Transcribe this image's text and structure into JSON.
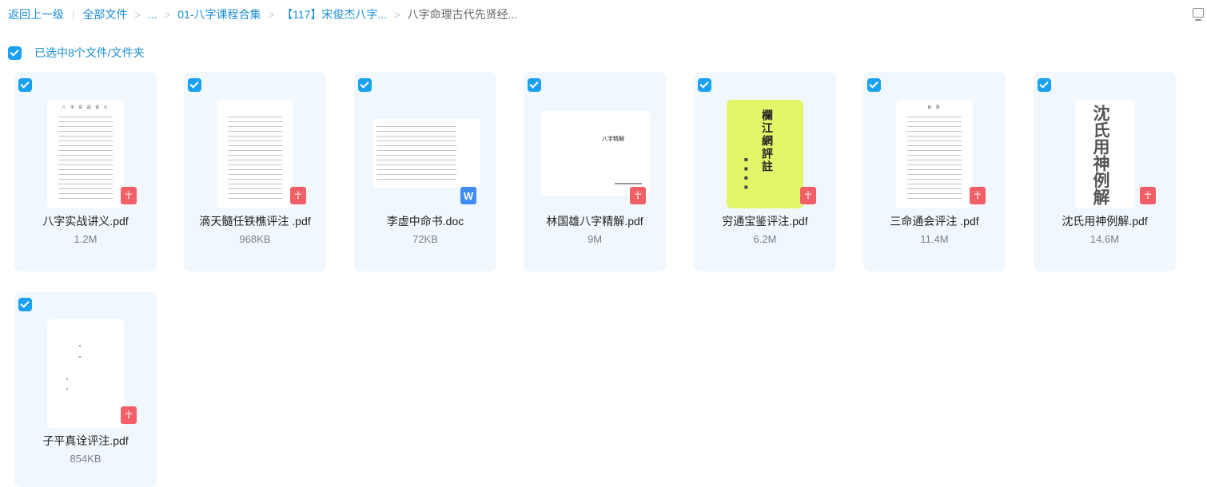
{
  "breadcrumb": {
    "back": "返回上一级",
    "all_files": "全部文件",
    "ellipsis": "...",
    "level1": "01-八字课程合集",
    "level2": "【117】宋俊杰八字...",
    "current": "八字命理古代先贤经..."
  },
  "selection": {
    "text": "已选中8个文件/文件夹"
  },
  "files": [
    {
      "name": "八字实战讲义.pdf",
      "size": "1.2M",
      "type": "pdf",
      "thumb_title": "八 字 实 战 讲 义"
    },
    {
      "name": "滴天髓任铁樵评注 .pdf",
      "size": "968KB",
      "type": "pdf"
    },
    {
      "name": "李虚中命书.doc",
      "size": "72KB",
      "type": "doc"
    },
    {
      "name": "林国雄八字精解.pdf",
      "size": "9M",
      "type": "pdf",
      "thumb_title": "八字精解"
    },
    {
      "name": "穷通宝鉴评注.pdf",
      "size": "6.2M",
      "type": "pdf",
      "thumb_title": "欄江網評註"
    },
    {
      "name": "三命通会评注 .pdf",
      "size": "11.4M",
      "type": "pdf",
      "thumb_title": "目 录"
    },
    {
      "name": "沈氏用神例解.pdf",
      "size": "14.6M",
      "type": "pdf",
      "thumb_title": "沈氏用神例解"
    },
    {
      "name": "子平真诠评注.pdf",
      "size": "854KB",
      "type": "pdf"
    }
  ],
  "icons": {
    "pdf_badge": "pdf-icon",
    "doc_badge": "word-doc-icon",
    "check": "checkmark-icon"
  },
  "colors": {
    "accent": "#1ba1f1",
    "card_bg": "#f1f8fd",
    "pdf": "#f25f66",
    "doc": "#3f8cf5"
  }
}
